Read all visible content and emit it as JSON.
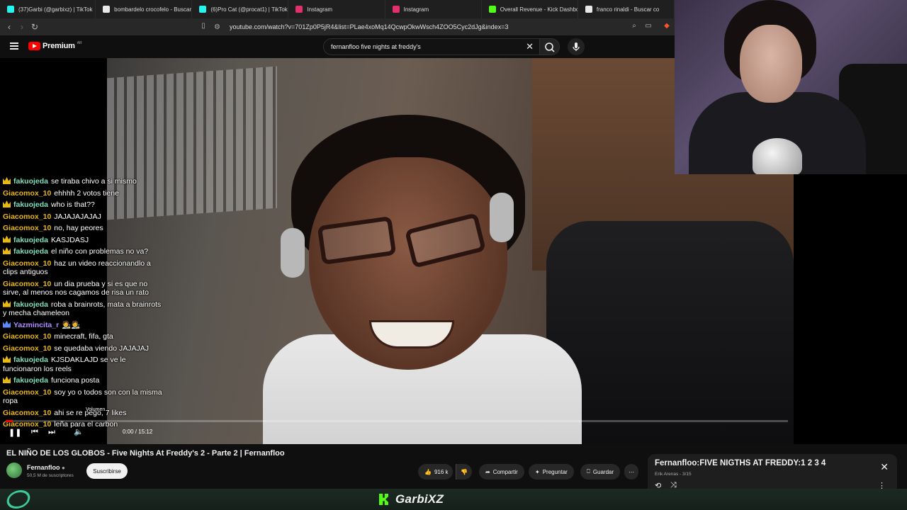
{
  "browser": {
    "tabs": [
      {
        "label": "(37)Garbi (@garbixz) | TikTok",
        "favicon": "tiktok-icon",
        "color": "#25f4ee"
      },
      {
        "label": "bombardelo crocofelo - Buscar c",
        "favicon": "google-icon",
        "color": "#e8e8e8"
      },
      {
        "label": "(6)Pro Cat (@procat1) | TikTok",
        "favicon": "tiktok-icon",
        "color": "#25f4ee"
      },
      {
        "label": "Instagram",
        "favicon": "instagram-icon",
        "color": "#e1306c"
      },
      {
        "label": "Instagram",
        "favicon": "instagram-icon",
        "color": "#e1306c"
      },
      {
        "label": "Overall Revenue - Kick Dashboa",
        "favicon": "kick-icon",
        "color": "#53fc18"
      },
      {
        "label": "franco rinaldi - Buscar co",
        "favicon": "google-icon",
        "color": "#e8e8e8"
      }
    ],
    "url": "youtube.com/watch?v=701Zp0P5jR4&list=PLae4xoMq14QcwpOkwWsch4ZOO5Cyc2dJg&index=3"
  },
  "youtube": {
    "logo_text": "Premium",
    "logo_suffix": "AR",
    "search_value": "fernanfloo five nights at freddy's"
  },
  "chat": [
    {
      "user": "fakuojeda",
      "color": "#7ee0c0",
      "badge": true,
      "text": "se tiraba chivo a si mismo"
    },
    {
      "user": "Giacomox_10",
      "color": "#e9b913",
      "badge": false,
      "text": "ehhhh 2 votos tiene"
    },
    {
      "user": "fakuojeda",
      "color": "#7ee0c0",
      "badge": true,
      "text": "who is that??"
    },
    {
      "user": "Giacomox_10",
      "color": "#e9b913",
      "badge": false,
      "text": "JAJAJAJAJAJ"
    },
    {
      "user": "Giacomox_10",
      "color": "#e9b913",
      "badge": false,
      "text": "no, hay peores"
    },
    {
      "user": "fakuojeda",
      "color": "#7ee0c0",
      "badge": true,
      "text": "KASJDASJ"
    },
    {
      "user": "fakuojeda",
      "color": "#7ee0c0",
      "badge": true,
      "text": "el niño con problemas no va?"
    },
    {
      "user": "Giacomox_10",
      "color": "#e9b913",
      "badge": false,
      "text": "haz un video reaccionandlo a clips antiguos"
    },
    {
      "user": "Giacomox_10",
      "color": "#e9b913",
      "badge": false,
      "text": "un dia prueba y si es que no sirve, al menos nos cagamos de risa un rato"
    },
    {
      "user": "fakuojeda",
      "color": "#7ee0c0",
      "badge": true,
      "text": "roba a brainrots, mata a brainrots y mecha chameleon"
    },
    {
      "user": "Yazmincita_r",
      "color": "#b08cff",
      "badge": true,
      "text": "🧑‍🎨🧑‍🎨"
    },
    {
      "user": "Giacomox_10",
      "color": "#e9b913",
      "badge": false,
      "text": "minecraft, fifa, gta"
    },
    {
      "user": "Giacomox_10",
      "color": "#e9b913",
      "badge": false,
      "text": "se quedaba viendo JAJAJAJ"
    },
    {
      "user": "fakuojeda",
      "color": "#7ee0c0",
      "badge": true,
      "text": "KJSDAKLAJD se ve le funcionaron los reels"
    },
    {
      "user": "fakuojeda",
      "color": "#7ee0c0",
      "badge": true,
      "text": "funciona posta"
    },
    {
      "user": "Giacomox_10",
      "color": "#e9b913",
      "badge": false,
      "text": "soy yo o todos son con la misma ropa"
    },
    {
      "user": "Giacomox_10",
      "color": "#e9b913",
      "badge": false,
      "text": "ahi se re pego, 7 likes"
    },
    {
      "user": "Giacomox_10",
      "color": "#e9b913",
      "badge": false,
      "text": "leña para el carbon"
    }
  ],
  "player": {
    "volume_label": "Volumen",
    "time": "0:00 / 15:12",
    "progress_fraction": 0.009
  },
  "video": {
    "title": "EL NIÑO DE LOS GLOBOS - Five Nights At Freddy's 2 - Parte 2 | Fernanfloo",
    "channel": "Fernanfloo",
    "subscribers": "50,5 M de suscriptores",
    "subscribe_label": "Suscribirse",
    "likes": "916 k",
    "share_label": "Compartir",
    "ask_label": "Preguntar",
    "save_label": "Guardar"
  },
  "playlist": {
    "title": "Fernanfloo:FIVE NIGTHS AT FREDDY:1 2 3 4",
    "subtitle": "Erik Arenas - 3/15"
  },
  "stream": {
    "brand": "GarbiXZ",
    "accent": "#53fc18"
  }
}
